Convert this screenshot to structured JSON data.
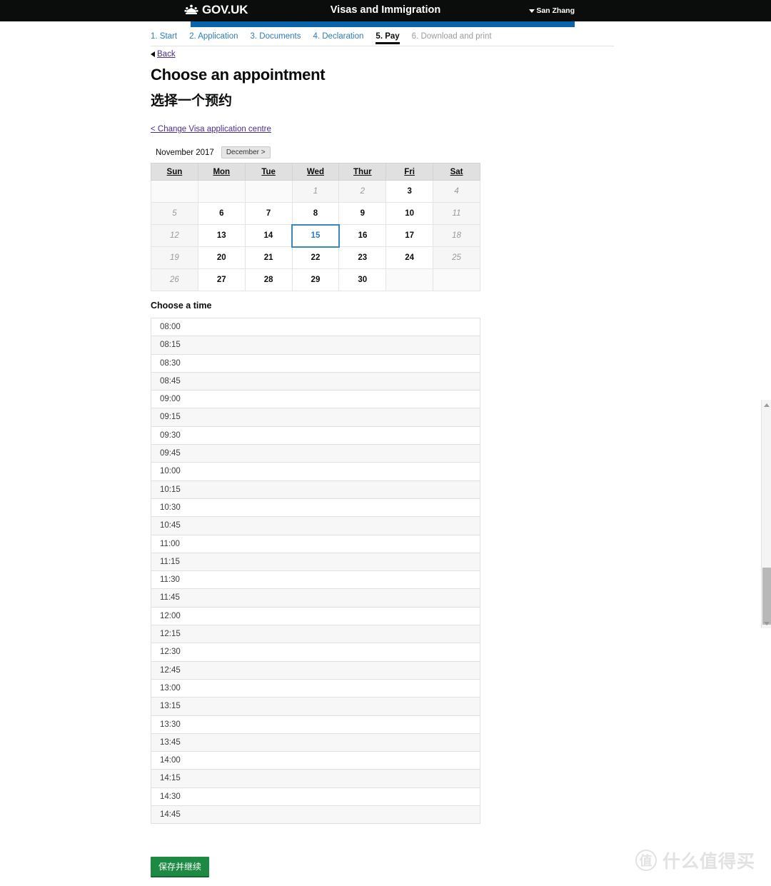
{
  "header": {
    "brand": "GOV.UK",
    "crown_icon": "crown-icon",
    "service_title": "Visas and Immigration",
    "account_name": "San Zhang",
    "caret_icon": "chevron-down-icon",
    "accent_blue": "#0b63ab",
    "bar_background": "#0b0c0c"
  },
  "steps": [
    {
      "label": "1. Start",
      "state": "link"
    },
    {
      "label": "2. Application",
      "state": "link"
    },
    {
      "label": "3. Documents",
      "state": "link"
    },
    {
      "label": "4. Declaration",
      "state": "link"
    },
    {
      "label": "5. Pay",
      "state": "current"
    },
    {
      "label": "6. Download and print",
      "state": "muted"
    }
  ],
  "back": {
    "label": "Back",
    "icon": "triangle-left-icon"
  },
  "main": {
    "title": "Choose an appointment",
    "subtitle": "选择一个预约",
    "change_centre_link": "< Change Visa application centre",
    "time_section_label": "Choose a time",
    "save_button": "保存并继续",
    "save_button_color": "#1c8a43"
  },
  "calendar": {
    "month_label": "November 2017",
    "next_month_button": "December >",
    "selected_day": "15",
    "selected_color": "#3a87bd",
    "day_headers": [
      "Sun",
      "Mon",
      "Tue",
      "Wed",
      "Thur",
      "Fri",
      "Sat"
    ],
    "weeks": [
      [
        {
          "day": "",
          "state": "empty"
        },
        {
          "day": "",
          "state": "empty"
        },
        {
          "day": "",
          "state": "empty"
        },
        {
          "day": "1",
          "state": "disabled"
        },
        {
          "day": "2",
          "state": "disabled"
        },
        {
          "day": "3",
          "state": "available"
        },
        {
          "day": "4",
          "state": "disabled"
        }
      ],
      [
        {
          "day": "5",
          "state": "disabled"
        },
        {
          "day": "6",
          "state": "available"
        },
        {
          "day": "7",
          "state": "available"
        },
        {
          "day": "8",
          "state": "available"
        },
        {
          "day": "9",
          "state": "available"
        },
        {
          "day": "10",
          "state": "available"
        },
        {
          "day": "11",
          "state": "disabled"
        }
      ],
      [
        {
          "day": "12",
          "state": "disabled"
        },
        {
          "day": "13",
          "state": "available"
        },
        {
          "day": "14",
          "state": "available"
        },
        {
          "day": "15",
          "state": "selected"
        },
        {
          "day": "16",
          "state": "available"
        },
        {
          "day": "17",
          "state": "available"
        },
        {
          "day": "18",
          "state": "disabled"
        }
      ],
      [
        {
          "day": "19",
          "state": "disabled"
        },
        {
          "day": "20",
          "state": "available"
        },
        {
          "day": "21",
          "state": "available"
        },
        {
          "day": "22",
          "state": "available"
        },
        {
          "day": "23",
          "state": "available"
        },
        {
          "day": "24",
          "state": "available"
        },
        {
          "day": "25",
          "state": "disabled"
        }
      ],
      [
        {
          "day": "26",
          "state": "disabled"
        },
        {
          "day": "27",
          "state": "available"
        },
        {
          "day": "28",
          "state": "available"
        },
        {
          "day": "29",
          "state": "available"
        },
        {
          "day": "30",
          "state": "available"
        },
        {
          "day": "",
          "state": "empty"
        },
        {
          "day": "",
          "state": "empty"
        }
      ]
    ]
  },
  "times": [
    "08:00",
    "08:15",
    "08:30",
    "08:45",
    "09:00",
    "09:15",
    "09:30",
    "09:45",
    "10:00",
    "10:15",
    "10:30",
    "10:45",
    "11:00",
    "11:15",
    "11:30",
    "11:45",
    "12:00",
    "12:15",
    "12:30",
    "12:45",
    "13:00",
    "13:15",
    "13:30",
    "13:45",
    "14:00",
    "14:15",
    "14:30",
    "14:45"
  ],
  "watermark": {
    "mark": "值",
    "text": "什么值得买"
  },
  "scrollbar": {
    "up_icon": "triangle-up-icon",
    "down_icon": "triangle-down-icon"
  }
}
